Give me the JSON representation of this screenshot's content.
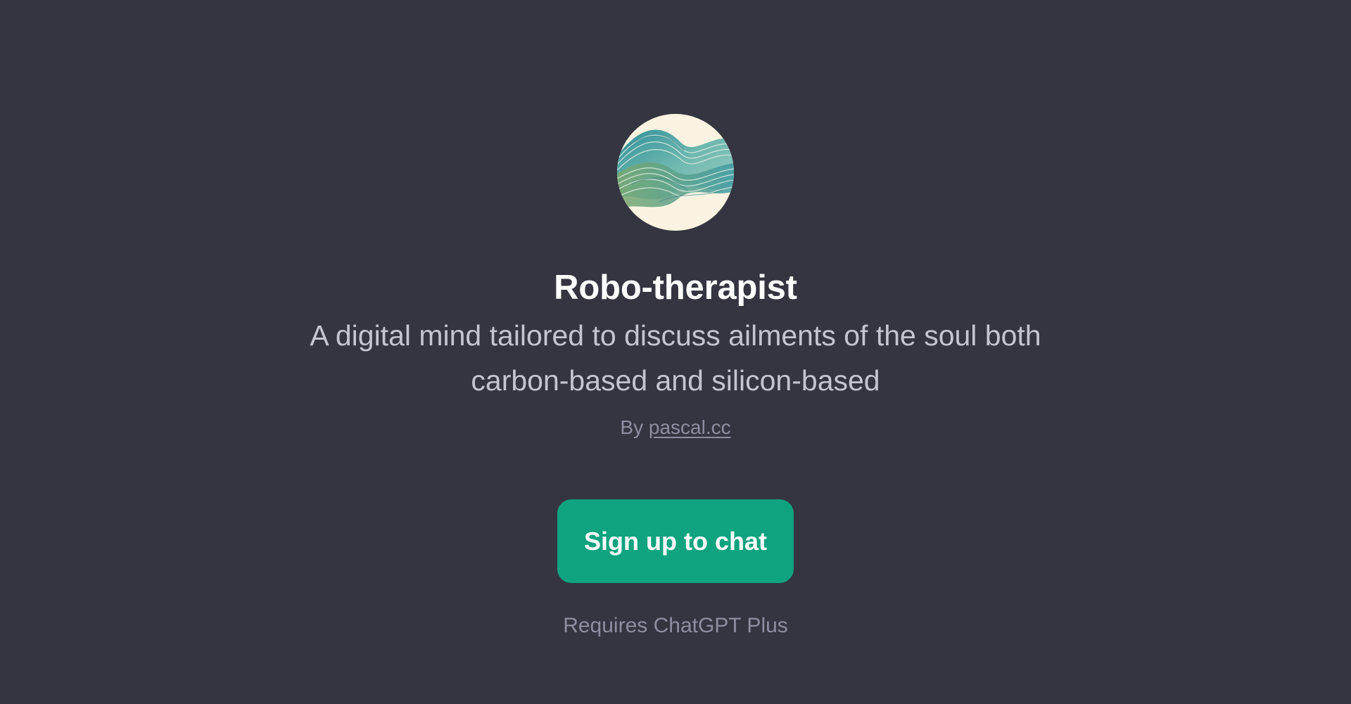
{
  "gpt": {
    "avatar_icon": "abstract-wave-avatar-icon",
    "name": "Robo-therapist",
    "description": "A digital mind tailored to discuss ailments of the soul both carbon-based and silicon-based",
    "byline_prefix": "By",
    "author": "pascal.cc"
  },
  "cta": {
    "signup_label": "Sign up to chat",
    "requirement_note": "Requires ChatGPT Plus"
  },
  "colors": {
    "background": "#343541",
    "accent": "#10a37f",
    "title_text": "#ffffff",
    "description_text": "#c5c5d2",
    "muted_text": "#8e8ea0"
  }
}
